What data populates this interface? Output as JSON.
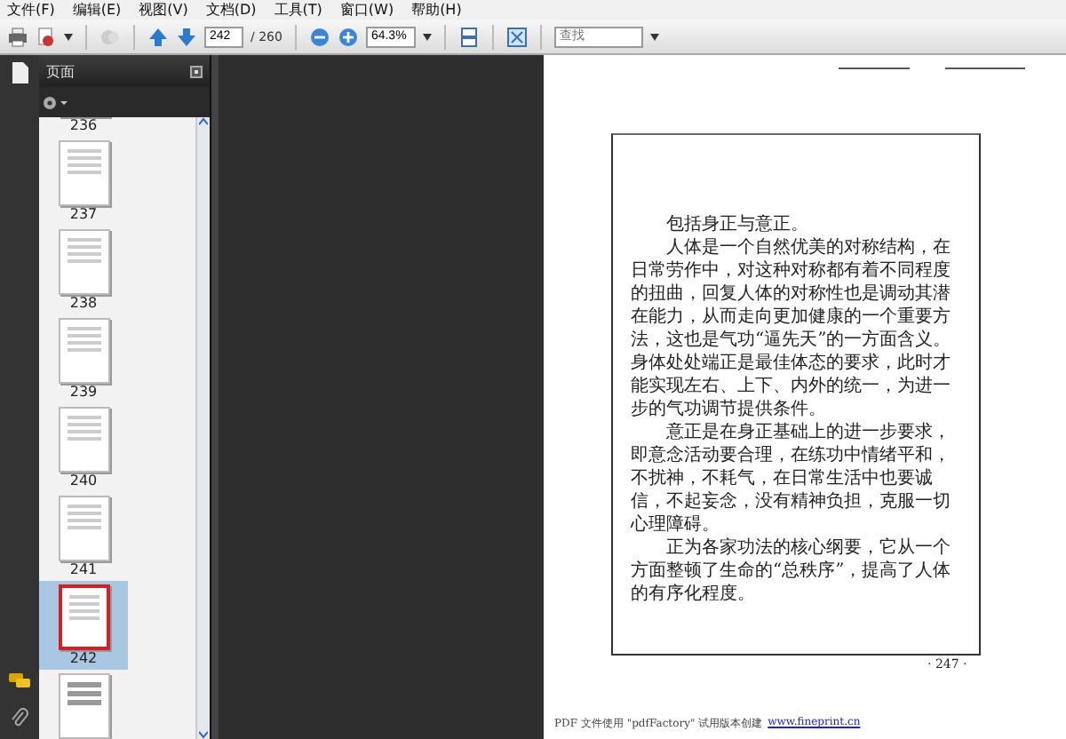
{
  "menu": [
    "文件(F)",
    "编辑(E)",
    "视图(V)",
    "文档(D)",
    "工具(T)",
    "窗口(W)",
    "帮助(H)"
  ],
  "toolbar": {
    "page_value": "242",
    "page_total": "/ 260",
    "zoom_value": "64.3%",
    "search_placeholder": "查找"
  },
  "panel": {
    "title": "页面",
    "thumbnails": [
      {
        "label": "236",
        "selected": false
      },
      {
        "label": "237",
        "selected": false
      },
      {
        "label": "238",
        "selected": false
      },
      {
        "label": "239",
        "selected": false
      },
      {
        "label": "240",
        "selected": false
      },
      {
        "label": "241",
        "selected": false
      },
      {
        "label": "242",
        "selected": true
      }
    ]
  },
  "document": {
    "paragraphs": [
      "包括身正与意正。",
      "人体是一个自然优美的对称结构，在日常劳作中，对这种对称都有着不同程度的扭曲，回复人体的对称性也是调动其潜在能力，从而走向更加健康的一个重要方法，这也是气功“逼先天”的一方面含义。身体处处端正是最佳体态的要求，此时才能实现左右、上下、内外的统一，为进一步的气功调节提供条件。",
      "意正是在身正基础上的进一步要求，即意念活动要合理，在练功中情绪平和，不扰神，不耗气，在日常生活中也要诚信，不起妄念，没有精神负担，克服一切心理障碍。",
      "正为各家功法的核心纲要，它从一个方面整顿了生命的“总秩序”，提高了人体的有序化程度。"
    ],
    "page_number": "· 247 ·",
    "footer_text": "PDF 文件使用 \"pdfFactory\" 试用版本创建",
    "footer_link": "www.fineprint.cn"
  }
}
